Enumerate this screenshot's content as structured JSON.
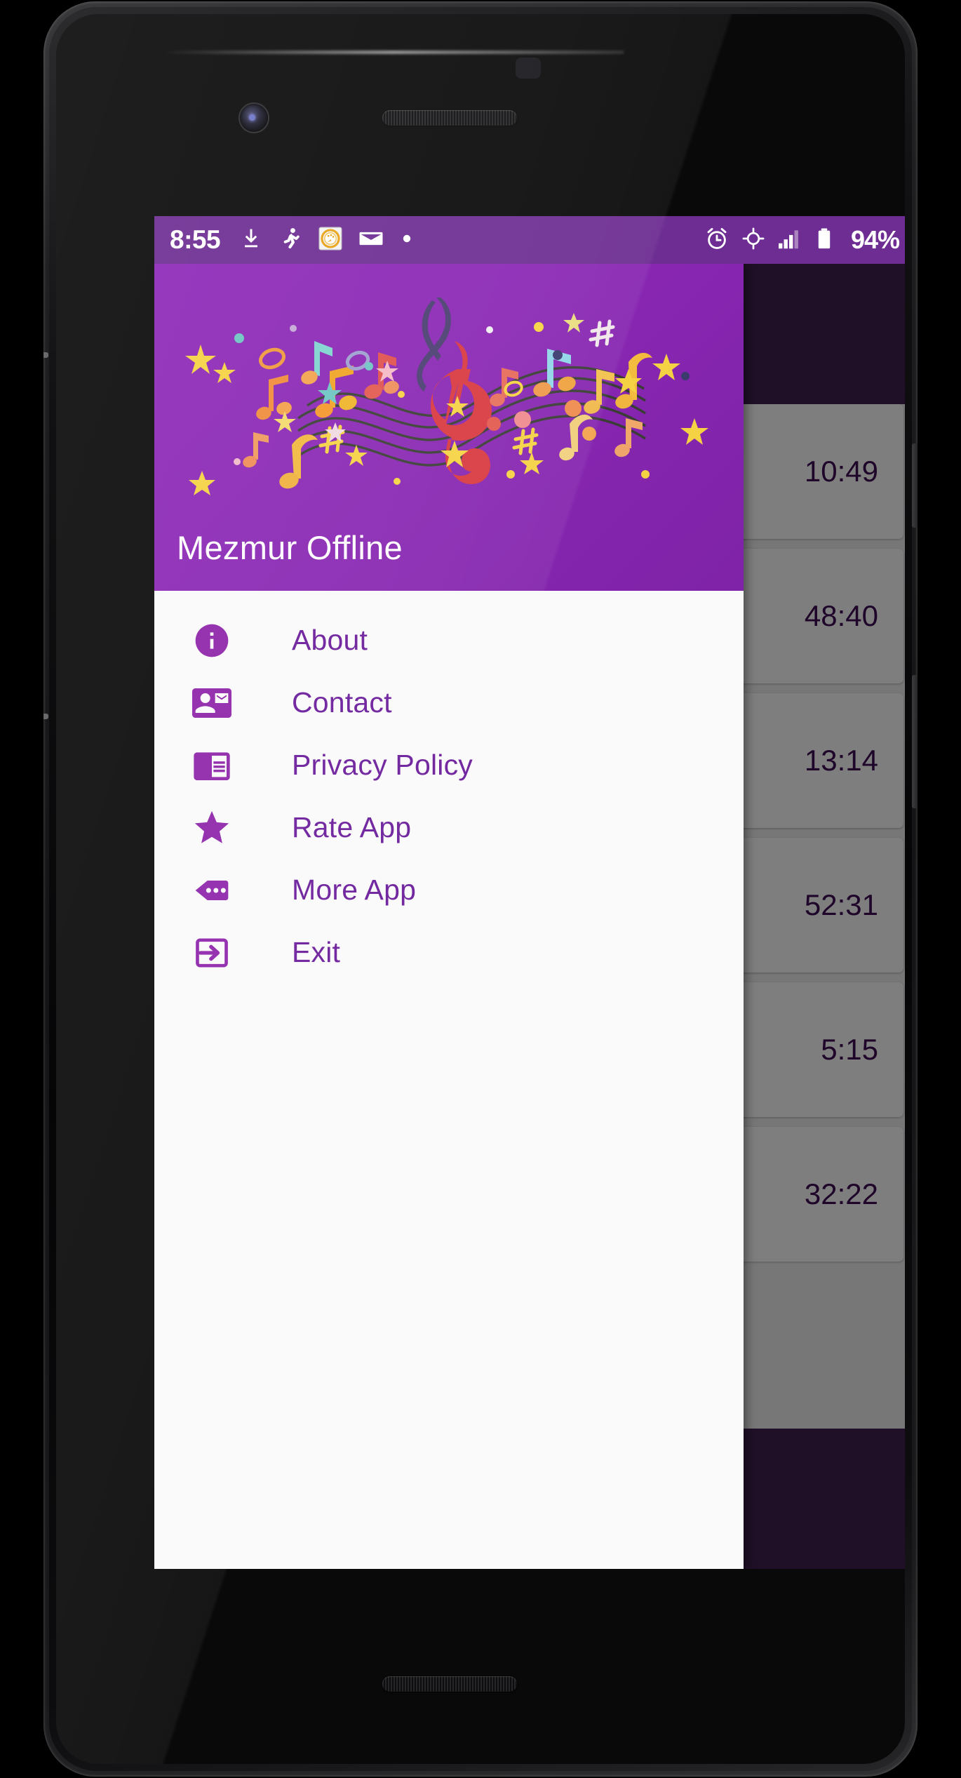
{
  "status_bar": {
    "clock": "8:55",
    "battery_percent": "94%",
    "left_icons": [
      {
        "name": "download-icon"
      },
      {
        "name": "fitness-person-icon"
      },
      {
        "name": "speedometer-badge-icon"
      },
      {
        "name": "email-icon"
      },
      {
        "name": "notification-dot-icon"
      }
    ],
    "right_icons": [
      {
        "name": "alarm-clock-icon"
      },
      {
        "name": "location-gps-icon"
      },
      {
        "name": "signal-bars-icon"
      },
      {
        "name": "battery-icon"
      }
    ],
    "background_color": "#6d2d92"
  },
  "drawer": {
    "title": "Mezmur Offline",
    "header_color": "#8a27b4",
    "accent_color": "#6a1b9a",
    "background_color": "#fafafa",
    "items": [
      {
        "label": "About",
        "icon": "info-circle-icon"
      },
      {
        "label": "Contact",
        "icon": "contact-mail-icon"
      },
      {
        "label": "Privacy Policy",
        "icon": "chrome-reader-mode-icon"
      },
      {
        "label": "Rate App",
        "icon": "star-icon"
      },
      {
        "label": "More App",
        "icon": "more-apps-icon"
      },
      {
        "label": "Exit",
        "icon": "exit-to-app-icon"
      }
    ]
  },
  "app_content": {
    "app_bar_color": "#3f1f4e",
    "songs": [
      {
        "duration": "10:49"
      },
      {
        "duration": "48:40"
      },
      {
        "duration": "13:14"
      },
      {
        "duration": "52:31"
      },
      {
        "duration": "5:15"
      },
      {
        "duration": "32:22"
      }
    ],
    "player": {
      "play_label": "play-button",
      "next_label": "next-button"
    }
  }
}
